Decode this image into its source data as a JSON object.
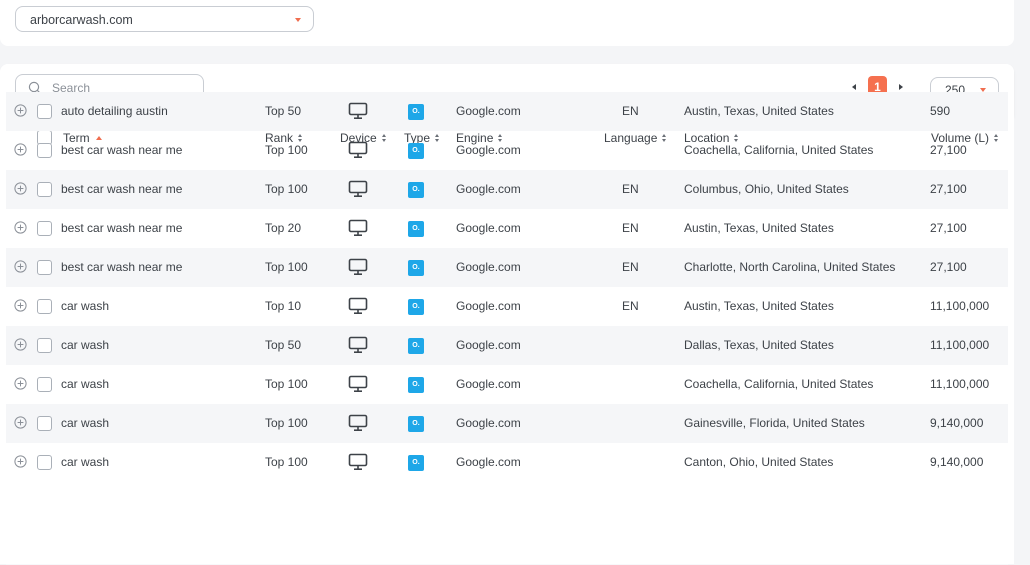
{
  "domain_select": {
    "value": "arborcarwash.com"
  },
  "search": {
    "placeholder": "Search"
  },
  "pagination": {
    "current_page": "1"
  },
  "per_page": {
    "value": "250"
  },
  "colors": {
    "accent": "#f5704f",
    "type_badge": "#1ea7e8",
    "row_alt": "#f5f6f8"
  },
  "table": {
    "headers": {
      "term": "Term",
      "rank": "Rank",
      "device": "Device",
      "type": "Type",
      "engine": "Engine",
      "language": "Language",
      "location": "Location",
      "volume": "Volume (L)"
    },
    "rows": [
      {
        "term": "auto detailing austin",
        "rank": "Top 50",
        "device": "desktop-icon",
        "type": "organic-icon",
        "engine": "Google.com",
        "language": "EN",
        "location": "Austin, Texas, United States",
        "volume": "590"
      },
      {
        "term": "best car wash near me",
        "rank": "Top 100",
        "device": "desktop-icon",
        "type": "organic-icon",
        "engine": "Google.com",
        "language": "",
        "location": "Coachella, California, United States",
        "volume": "27,100"
      },
      {
        "term": "best car wash near me",
        "rank": "Top 100",
        "device": "desktop-icon",
        "type": "organic-icon",
        "engine": "Google.com",
        "language": "EN",
        "location": "Columbus, Ohio, United States",
        "volume": "27,100"
      },
      {
        "term": "best car wash near me",
        "rank": "Top 20",
        "device": "desktop-icon",
        "type": "organic-icon",
        "engine": "Google.com",
        "language": "EN",
        "location": "Austin, Texas, United States",
        "volume": "27,100"
      },
      {
        "term": "best car wash near me",
        "rank": "Top 100",
        "device": "desktop-icon",
        "type": "organic-icon",
        "engine": "Google.com",
        "language": "EN",
        "location": "Charlotte, North Carolina, United States",
        "volume": "27,100"
      },
      {
        "term": "car wash",
        "rank": "Top 10",
        "device": "desktop-icon",
        "type": "organic-icon",
        "engine": "Google.com",
        "language": "EN",
        "location": "Austin, Texas, United States",
        "volume": "11,100,000"
      },
      {
        "term": "car wash",
        "rank": "Top 50",
        "device": "desktop-icon",
        "type": "organic-icon",
        "engine": "Google.com",
        "language": "",
        "location": "Dallas, Texas, United States",
        "volume": "11,100,000"
      },
      {
        "term": "car wash",
        "rank": "Top 100",
        "device": "desktop-icon",
        "type": "organic-icon",
        "engine": "Google.com",
        "language": "",
        "location": "Coachella, California, United States",
        "volume": "11,100,000"
      },
      {
        "term": "car wash",
        "rank": "Top 100",
        "device": "desktop-icon",
        "type": "organic-icon",
        "engine": "Google.com",
        "language": "",
        "location": "Gainesville, Florida, United States",
        "volume": "9,140,000"
      },
      {
        "term": "car wash",
        "rank": "Top 100",
        "device": "desktop-icon",
        "type": "organic-icon",
        "engine": "Google.com",
        "language": "",
        "location": "Canton, Ohio, United States",
        "volume": "9,140,000"
      }
    ]
  }
}
